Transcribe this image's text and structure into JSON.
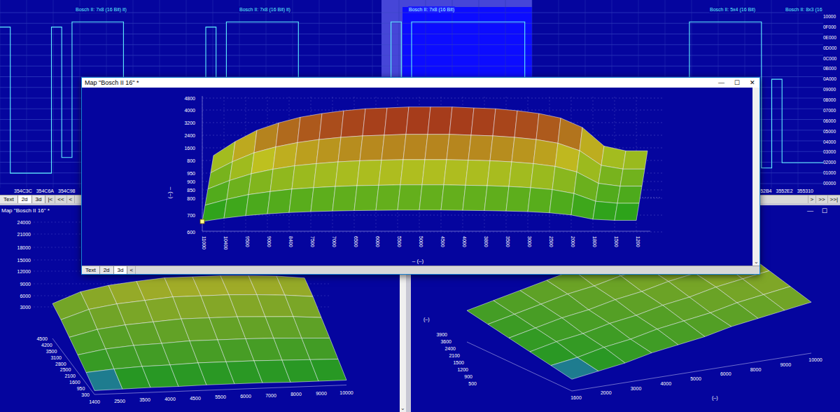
{
  "hex_view": {
    "map_labels": [
      {
        "label": "Bosch II: 7x8 (16 Bit)  it)",
        "selected": false
      },
      {
        "label": "Bosch II: 7x8 (16 Bit)  it)",
        "selected": false
      },
      {
        "label": "Bosch II: 7x8 (16 Bit)",
        "selected": true
      },
      {
        "label": "Bosch II: 5x4 (16 Bit)",
        "selected": false
      },
      {
        "label": "Bosch II: 8x3 (16",
        "selected": false
      }
    ],
    "value_axis": [
      "10000",
      "0F000",
      "0E000",
      "0D000",
      "0C000",
      "0B000",
      "0A000",
      "09000",
      "08000",
      "07000",
      "06000",
      "05000",
      "04000",
      "03000",
      "02000",
      "01000",
      "00000"
    ],
    "trace": [
      60000,
      4000,
      4000,
      4000,
      4000,
      60000,
      10000,
      62000,
      62000,
      62000,
      62000,
      62000,
      2000,
      2000,
      2000,
      2000,
      2000,
      2000,
      2000,
      2000,
      60000,
      30000,
      62000,
      62000,
      62000,
      62000,
      62000,
      62000,
      62000,
      1500,
      1500,
      1500,
      1500,
      1500,
      1500,
      1500,
      1500,
      1500,
      62000,
      30000,
      62000,
      62000,
      62000,
      62000,
      62000,
      62000,
      62000,
      62000,
      62000,
      62000,
      62000,
      3000,
      3000,
      3000,
      3000,
      3000,
      3000,
      3000,
      3000,
      3000,
      3000,
      3000,
      3000,
      3000,
      3000,
      3000,
      3000,
      62000,
      62000,
      62000,
      62000,
      62000,
      62000,
      62000,
      6000,
      40000,
      8000,
      8000,
      8000,
      8000
    ],
    "addresses_left": [
      "354C3C",
      "354C6A",
      "354C98"
    ],
    "addresses_right": [
      "3552B4",
      "3552E2",
      "355310"
    ],
    "tabs": [
      {
        "label": "Text",
        "selected": false
      },
      {
        "label": "2d",
        "selected": true
      },
      {
        "label": "3d",
        "selected": false
      }
    ],
    "nav_left": [
      "|<",
      "<<",
      "<"
    ],
    "nav_right": [
      ">",
      ">>",
      ">>|"
    ]
  },
  "map_window": {
    "title": "Map \"Bosch II 16\" *",
    "controls": [
      "—",
      "☐",
      "✕"
    ],
    "y_labels": [
      "4800",
      "4000",
      "3200",
      "2400",
      "1600",
      "800",
      "950",
      "900",
      "850",
      "800",
      "700",
      "600"
    ],
    "x_labels": [
      "11000",
      "10400",
      "9500",
      "9000",
      "8400",
      "7500",
      "7000",
      "6500",
      "6000",
      "5500",
      "5000",
      "4500",
      "4000",
      "3800",
      "3500",
      "3000",
      "2500",
      "2000",
      "1800",
      "1500",
      "1200"
    ],
    "x_title": "–  (–)",
    "y_title": "(–) –",
    "values": [
      [
        450,
        600,
        720,
        800,
        860,
        900,
        930,
        950,
        960,
        970,
        970,
        970,
        960,
        950,
        930,
        900,
        850,
        750,
        550,
        500,
        500
      ],
      [
        810,
        1080,
        1300,
        1440,
        1550,
        1620,
        1670,
        1710,
        1730,
        1750,
        1750,
        1750,
        1730,
        1710,
        1670,
        1620,
        1530,
        1350,
        990,
        900,
        900
      ],
      [
        1170,
        1560,
        1870,
        2080,
        2240,
        2340,
        2420,
        2470,
        2500,
        2520,
        2520,
        2520,
        2500,
        2470,
        2420,
        2340,
        2210,
        1950,
        1430,
        1300,
        1300
      ],
      [
        1530,
        2040,
        2450,
        2720,
        2920,
        3060,
        3160,
        3230,
        3260,
        3300,
        3300,
        3300,
        3260,
        3230,
        3160,
        3060,
        2890,
        2550,
        1870,
        1700,
        1700
      ],
      [
        1940,
        2580,
        3100,
        3440,
        3700,
        3870,
        4000,
        4090,
        4130,
        4170,
        4170,
        4170,
        4130,
        4090,
        4000,
        3870,
        3660,
        3230,
        2370,
        2150,
        2150
      ]
    ],
    "selected_cell": {
      "row": 0,
      "col": 0
    },
    "tabs": [
      {
        "label": "Text",
        "selected": false
      },
      {
        "label": "2d",
        "selected": false
      },
      {
        "label": "3d",
        "selected": true
      }
    ],
    "nav": [
      "<"
    ],
    "scroll_arrow": "⌄"
  },
  "left_window": {
    "title": "Map \"Bosch II 16\" *",
    "y_labels": [
      "24000",
      "21000",
      "18000",
      "15000",
      "12000",
      "9000",
      "6000",
      "3000"
    ],
    "row_labels": [
      "4500",
      "4200",
      "3500",
      "3100",
      "2800",
      "2500",
      "2100",
      "1600",
      "950",
      "300"
    ],
    "col_labels": [
      "1400",
      "2500",
      "3500",
      "4000",
      "4500",
      "5500",
      "6000",
      "7000",
      "8000",
      "9000",
      "10000"
    ],
    "values": [
      [
        800,
        900,
        1000,
        1000,
        1100,
        1100,
        1100,
        1000,
        1000,
        1000
      ],
      [
        2200,
        2700,
        3000,
        3100,
        3300,
        3300,
        3300,
        3200,
        3100,
        3000
      ],
      [
        3500,
        4500,
        5000,
        5200,
        5500,
        5500,
        5500,
        5400,
        5200,
        5000
      ],
      [
        4800,
        6200,
        6900,
        7300,
        7700,
        7700,
        7700,
        7500,
        7300,
        6900
      ],
      [
        6100,
        8000,
        8900,
        9400,
        9900,
        9900,
        9900,
        9700,
        9400,
        8900
      ],
      [
        7100,
        9300,
        10400,
        11000,
        11500,
        11500,
        11500,
        11300,
        11000,
        10400
      ]
    ],
    "scroll_arrow": "⌄"
  },
  "right_window": {
    "controls": [
      "—",
      "☐"
    ],
    "y_labels": [
      "3900",
      "3600",
      "2400",
      "2100",
      "1500",
      "1200",
      "900",
      "500"
    ],
    "col_labels": [
      "1600",
      "2000",
      "3000",
      "4000",
      "5000",
      "6000",
      "8000",
      "9000",
      "10000"
    ],
    "x_title": "(–)",
    "y_title": "(–)",
    "values": [
      [
        600,
        800,
        1000,
        1300,
        1500,
        1700,
        2000,
        2200,
        2400,
        2600
      ],
      [
        800,
        1000,
        1300,
        1500,
        1800,
        2000,
        2200,
        2500,
        2700,
        2900
      ],
      [
        1000,
        1300,
        1500,
        1800,
        2000,
        2300,
        2500,
        2800,
        3000,
        3200
      ],
      [
        1200,
        1500,
        1800,
        2000,
        2300,
        2500,
        2800,
        3000,
        3300,
        3500
      ],
      [
        1400,
        1700,
        2000,
        2300,
        2500,
        2800,
        3000,
        3300,
        3500,
        3700
      ],
      [
        1600,
        1900,
        2200,
        2500,
        2800,
        3000,
        3300,
        3500,
        3700,
        3900
      ]
    ]
  }
}
